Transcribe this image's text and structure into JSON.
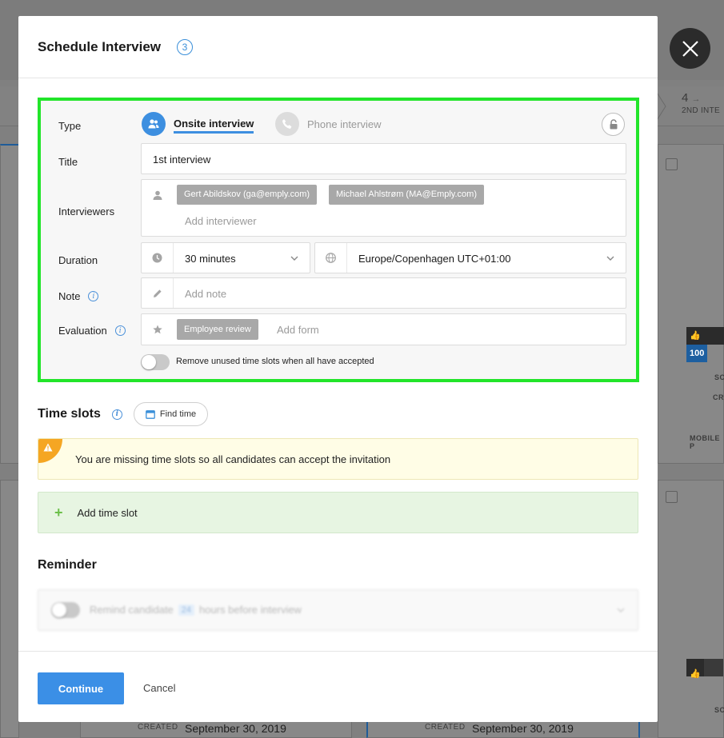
{
  "modal": {
    "title": "Schedule Interview",
    "step_number": "3"
  },
  "type": {
    "label": "Type",
    "options": [
      {
        "label": "Onsite interview",
        "selected": true,
        "icon": "people-icon"
      },
      {
        "label": "Phone interview",
        "selected": false,
        "icon": "phone-icon"
      }
    ],
    "lock_icon": "unlock-icon"
  },
  "title_field": {
    "label": "Title",
    "value": "1st interview"
  },
  "interviewers": {
    "label": "Interviewers",
    "tags": [
      "Gert Abildskov (ga@emply.com)",
      "Michael Ahlstrøm (MA@Emply.com)"
    ],
    "placeholder": "Add interviewer"
  },
  "duration": {
    "label": "Duration",
    "value": "30 minutes",
    "timezone": "Europe/Copenhagen UTC+01:00"
  },
  "note": {
    "label": "Note",
    "placeholder": "Add note"
  },
  "evaluation": {
    "label": "Evaluation",
    "tag": "Employee review",
    "placeholder": "Add form"
  },
  "remove_unused": {
    "label": "Remove unused time slots when all have accepted",
    "on": false
  },
  "time_slots": {
    "title": "Time slots",
    "find_time_label": "Find time",
    "warning": "You are missing time slots so all candidates can accept the invitation",
    "add_label": "Add time slot"
  },
  "reminder": {
    "title": "Reminder",
    "prefix": "Remind candidate",
    "hours": "24",
    "suffix": "hours before interview",
    "on": false
  },
  "footer": {
    "continue_label": "Continue",
    "cancel_label": "Cancel"
  },
  "background": {
    "step_number": "4",
    "step_label": "2ND INTE",
    "like_percent": "100",
    "labels": [
      "SC",
      "CR",
      "MOBILE P",
      "SC"
    ],
    "created_label": "CREATED",
    "created_date": "September 30, 2019"
  },
  "colors": {
    "accent": "#3b8fe6",
    "highlight_border": "#22e52a",
    "warning": "#f5a623",
    "success_bg": "#e7f5e2"
  }
}
